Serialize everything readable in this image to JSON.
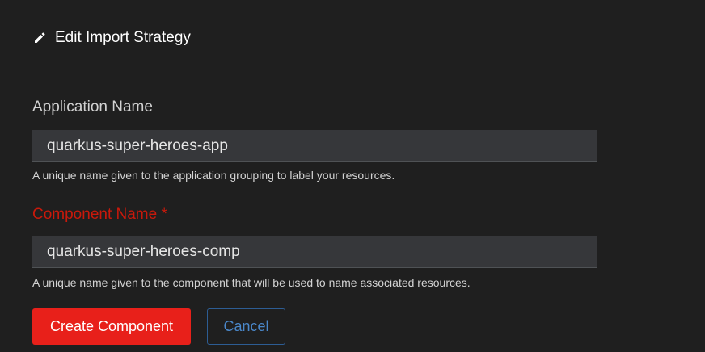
{
  "header": {
    "icon": "pencil-icon",
    "title": "Edit Import Strategy"
  },
  "application_name": {
    "label": "Application Name",
    "value": "quarkus-super-heroes-app",
    "help": "A unique name given to the application grouping to label your resources."
  },
  "component_name": {
    "label": "Component Name",
    "required_marker": "*",
    "value": "quarkus-super-heroes-comp",
    "help": "A unique name given to the component that will be used to name associated resources."
  },
  "actions": {
    "create_label": "Create Component",
    "cancel_label": "Cancel"
  },
  "colors": {
    "background": "#1f1f1f",
    "primary": "#e8201a",
    "required": "#c9190b",
    "link": "#4a87c9"
  }
}
